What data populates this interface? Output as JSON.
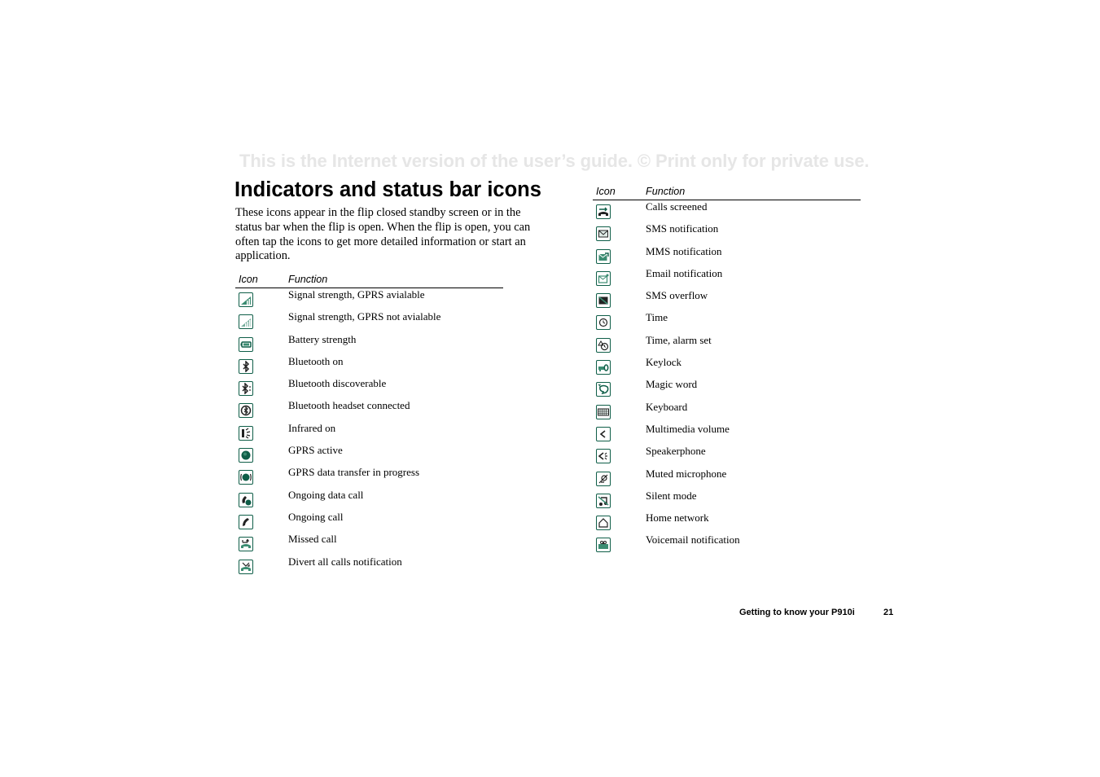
{
  "watermark": "This is the Internet version of the user’s guide. © Print only for private use.",
  "title": "Indicators and status bar icons",
  "intro": "These icons appear in the flip closed standby screen or in the status bar when the flip is open. When the flip is open, you can often tap the icons to get more detailed information or start an application.",
  "table_headers": {
    "icon": "Icon",
    "function": "Function"
  },
  "left_table": [
    {
      "icon": "signal-gprs-available-icon",
      "function": "Signal strength, GPRS avialable"
    },
    {
      "icon": "signal-gprs-not-available-icon",
      "function": "Signal strength, GPRS not avialable"
    },
    {
      "icon": "battery-icon",
      "function": "Battery strength"
    },
    {
      "icon": "bluetooth-icon",
      "function": "Bluetooth on"
    },
    {
      "icon": "bluetooth-discoverable-icon",
      "function": "Bluetooth discoverable"
    },
    {
      "icon": "bluetooth-headset-icon",
      "function": "Bluetooth headset connected"
    },
    {
      "icon": "infrared-icon",
      "function": "Infrared on"
    },
    {
      "icon": "gprs-active-icon",
      "function": "GPRS active"
    },
    {
      "icon": "gprs-transfer-icon",
      "function": "GPRS data transfer in progress"
    },
    {
      "icon": "data-call-icon",
      "function": "Ongoing data call"
    },
    {
      "icon": "call-icon",
      "function": "Ongoing call"
    },
    {
      "icon": "missed-call-icon",
      "function": "Missed call"
    },
    {
      "icon": "divert-calls-icon",
      "function": "Divert all calls notification"
    }
  ],
  "right_table": [
    {
      "icon": "calls-screened-icon",
      "function": "Calls screened"
    },
    {
      "icon": "sms-icon",
      "function": "SMS notification"
    },
    {
      "icon": "mms-icon",
      "function": "MMS notification"
    },
    {
      "icon": "email-icon",
      "function": "Email notification"
    },
    {
      "icon": "sms-overflow-icon",
      "function": "SMS overflow"
    },
    {
      "icon": "clock-icon",
      "function": "Time"
    },
    {
      "icon": "alarm-icon",
      "function": "Time, alarm set"
    },
    {
      "icon": "keylock-icon",
      "function": "Keylock"
    },
    {
      "icon": "magic-word-icon",
      "function": "Magic word"
    },
    {
      "icon": "keyboard-icon",
      "function": "Keyboard"
    },
    {
      "icon": "volume-icon",
      "function": "Multimedia volume"
    },
    {
      "icon": "speakerphone-icon",
      "function": "Speakerphone"
    },
    {
      "icon": "muted-microphone-icon",
      "function": "Muted microphone"
    },
    {
      "icon": "silent-mode-icon",
      "function": "Silent mode"
    },
    {
      "icon": "home-network-icon",
      "function": "Home network"
    },
    {
      "icon": "voicemail-icon",
      "function": "Voicemail notification"
    }
  ],
  "footer": {
    "section": "Getting to know your P910i",
    "page": "21"
  },
  "colors": {
    "icon_accent": "#0f5e48",
    "icon_fill": "#3c8c72",
    "watermark": "#e6e6e6"
  }
}
